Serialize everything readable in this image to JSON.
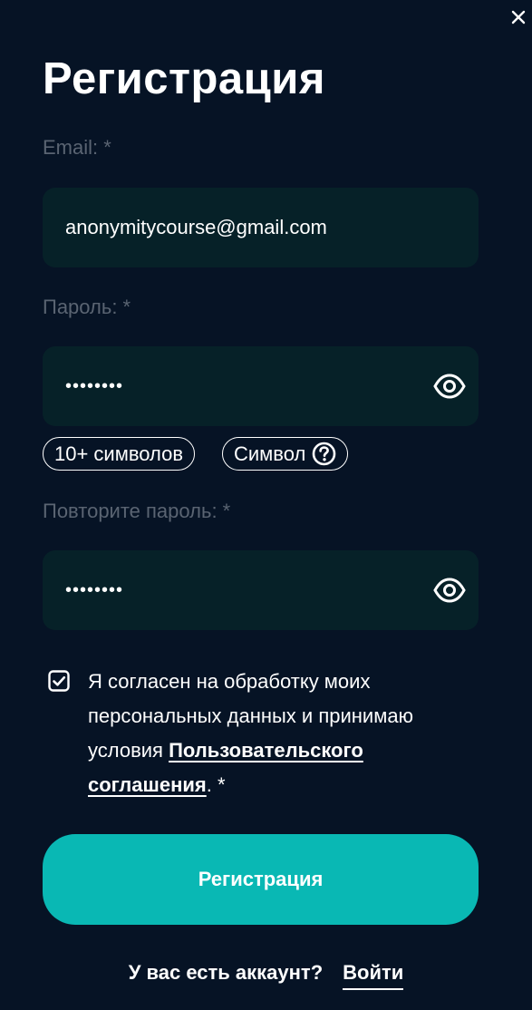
{
  "dialog": {
    "title": "Регистрация",
    "close_icon": "close-icon"
  },
  "form": {
    "email": {
      "label": "Email: *",
      "value": "anonymitycourse@gmail.com"
    },
    "password": {
      "label": "Пароль: *",
      "value": "••••••••",
      "toggle_icon": "eye-icon"
    },
    "password_hints": [
      {
        "text": "10+ символов"
      },
      {
        "text": "Символ",
        "icon": "question-circle-icon"
      }
    ],
    "repeat_password": {
      "label": "Повторите пароль: *",
      "value": "••••••••",
      "toggle_icon": "eye-icon"
    },
    "consent": {
      "checked": true,
      "text_before": "Я согласен на обработку моих персональных данных и принимаю условия ",
      "link_text": "Пользовательского соглашения",
      "text_after": ". *"
    },
    "submit_label": "Регистрация"
  },
  "footer": {
    "question": "У вас есть аккаунт?",
    "login_label": "Войти"
  },
  "colors": {
    "background": "#061325",
    "field_bg": "#062128",
    "accent": "#09b8b4",
    "label": "#5a6472",
    "text": "#ffffff"
  }
}
